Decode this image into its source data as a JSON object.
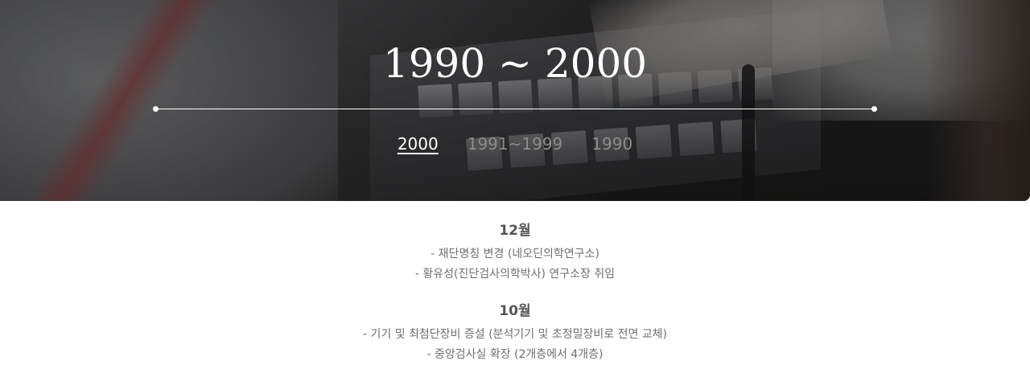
{
  "hero": {
    "period_title": "1990 ~ 2000",
    "tabs": [
      {
        "label": "2000",
        "active": true
      },
      {
        "label": "1991~1999",
        "active": false
      },
      {
        "label": "1990",
        "active": false
      }
    ]
  },
  "history": [
    {
      "month": "12월",
      "events": [
        "- 재단명칭 변경 (네오딘의학연구소)",
        "- 황유성(진단검사의학박사) 연구소장 취임"
      ]
    },
    {
      "month": "10월",
      "events": [
        "- 기기 및 최첨단장비 증설 (분석기기 및 초정밀장비로 전면 교체)",
        "- 중앙검사실 확장 (2개층에서 4개층)"
      ]
    }
  ],
  "colors": {
    "tab_active": "#ffffff",
    "tab_inactive": "#8c8c8c",
    "month_title": "#555555",
    "event_text": "#6f6f6f"
  }
}
